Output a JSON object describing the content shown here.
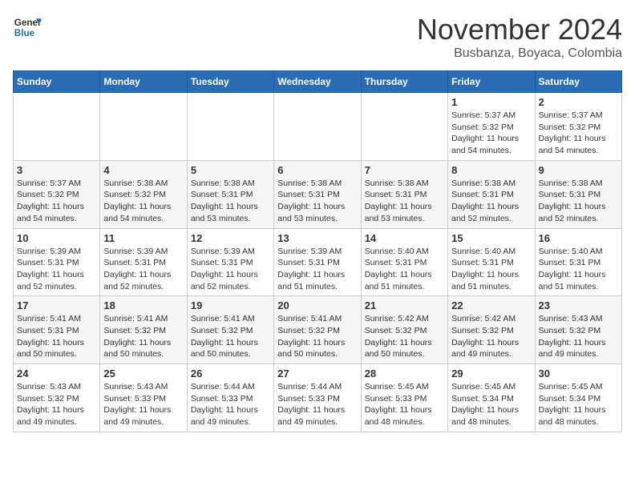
{
  "header": {
    "logo_line1": "General",
    "logo_line2": "Blue",
    "month_title": "November 2024",
    "location": "Busbanza, Boyaca, Colombia"
  },
  "weekdays": [
    "Sunday",
    "Monday",
    "Tuesday",
    "Wednesday",
    "Thursday",
    "Friday",
    "Saturday"
  ],
  "weeks": [
    [
      {
        "day": "",
        "info": ""
      },
      {
        "day": "",
        "info": ""
      },
      {
        "day": "",
        "info": ""
      },
      {
        "day": "",
        "info": ""
      },
      {
        "day": "",
        "info": ""
      },
      {
        "day": "1",
        "info": "Sunrise: 5:37 AM\nSunset: 5:32 PM\nDaylight: 11 hours\nand 54 minutes."
      },
      {
        "day": "2",
        "info": "Sunrise: 5:37 AM\nSunset: 5:32 PM\nDaylight: 11 hours\nand 54 minutes."
      }
    ],
    [
      {
        "day": "3",
        "info": "Sunrise: 5:37 AM\nSunset: 5:32 PM\nDaylight: 11 hours\nand 54 minutes."
      },
      {
        "day": "4",
        "info": "Sunrise: 5:38 AM\nSunset: 5:32 PM\nDaylight: 11 hours\nand 54 minutes."
      },
      {
        "day": "5",
        "info": "Sunrise: 5:38 AM\nSunset: 5:31 PM\nDaylight: 11 hours\nand 53 minutes."
      },
      {
        "day": "6",
        "info": "Sunrise: 5:38 AM\nSunset: 5:31 PM\nDaylight: 11 hours\nand 53 minutes."
      },
      {
        "day": "7",
        "info": "Sunrise: 5:38 AM\nSunset: 5:31 PM\nDaylight: 11 hours\nand 53 minutes."
      },
      {
        "day": "8",
        "info": "Sunrise: 5:38 AM\nSunset: 5:31 PM\nDaylight: 11 hours\nand 52 minutes."
      },
      {
        "day": "9",
        "info": "Sunrise: 5:38 AM\nSunset: 5:31 PM\nDaylight: 11 hours\nand 52 minutes."
      }
    ],
    [
      {
        "day": "10",
        "info": "Sunrise: 5:39 AM\nSunset: 5:31 PM\nDaylight: 11 hours\nand 52 minutes."
      },
      {
        "day": "11",
        "info": "Sunrise: 5:39 AM\nSunset: 5:31 PM\nDaylight: 11 hours\nand 52 minutes."
      },
      {
        "day": "12",
        "info": "Sunrise: 5:39 AM\nSunset: 5:31 PM\nDaylight: 11 hours\nand 52 minutes."
      },
      {
        "day": "13",
        "info": "Sunrise: 5:39 AM\nSunset: 5:31 PM\nDaylight: 11 hours\nand 51 minutes."
      },
      {
        "day": "14",
        "info": "Sunrise: 5:40 AM\nSunset: 5:31 PM\nDaylight: 11 hours\nand 51 minutes."
      },
      {
        "day": "15",
        "info": "Sunrise: 5:40 AM\nSunset: 5:31 PM\nDaylight: 11 hours\nand 51 minutes."
      },
      {
        "day": "16",
        "info": "Sunrise: 5:40 AM\nSunset: 5:31 PM\nDaylight: 11 hours\nand 51 minutes."
      }
    ],
    [
      {
        "day": "17",
        "info": "Sunrise: 5:41 AM\nSunset: 5:31 PM\nDaylight: 11 hours\nand 50 minutes."
      },
      {
        "day": "18",
        "info": "Sunrise: 5:41 AM\nSunset: 5:32 PM\nDaylight: 11 hours\nand 50 minutes."
      },
      {
        "day": "19",
        "info": "Sunrise: 5:41 AM\nSunset: 5:32 PM\nDaylight: 11 hours\nand 50 minutes."
      },
      {
        "day": "20",
        "info": "Sunrise: 5:41 AM\nSunset: 5:32 PM\nDaylight: 11 hours\nand 50 minutes."
      },
      {
        "day": "21",
        "info": "Sunrise: 5:42 AM\nSunset: 5:32 PM\nDaylight: 11 hours\nand 50 minutes."
      },
      {
        "day": "22",
        "info": "Sunrise: 5:42 AM\nSunset: 5:32 PM\nDaylight: 11 hours\nand 49 minutes."
      },
      {
        "day": "23",
        "info": "Sunrise: 5:43 AM\nSunset: 5:32 PM\nDaylight: 11 hours\nand 49 minutes."
      }
    ],
    [
      {
        "day": "24",
        "info": "Sunrise: 5:43 AM\nSunset: 5:32 PM\nDaylight: 11 hours\nand 49 minutes."
      },
      {
        "day": "25",
        "info": "Sunrise: 5:43 AM\nSunset: 5:33 PM\nDaylight: 11 hours\nand 49 minutes."
      },
      {
        "day": "26",
        "info": "Sunrise: 5:44 AM\nSunset: 5:33 PM\nDaylight: 11 hours\nand 49 minutes."
      },
      {
        "day": "27",
        "info": "Sunrise: 5:44 AM\nSunset: 5:33 PM\nDaylight: 11 hours\nand 49 minutes."
      },
      {
        "day": "28",
        "info": "Sunrise: 5:45 AM\nSunset: 5:33 PM\nDaylight: 11 hours\nand 48 minutes."
      },
      {
        "day": "29",
        "info": "Sunrise: 5:45 AM\nSunset: 5:34 PM\nDaylight: 11 hours\nand 48 minutes."
      },
      {
        "day": "30",
        "info": "Sunrise: 5:45 AM\nSunset: 5:34 PM\nDaylight: 11 hours\nand 48 minutes."
      }
    ]
  ]
}
